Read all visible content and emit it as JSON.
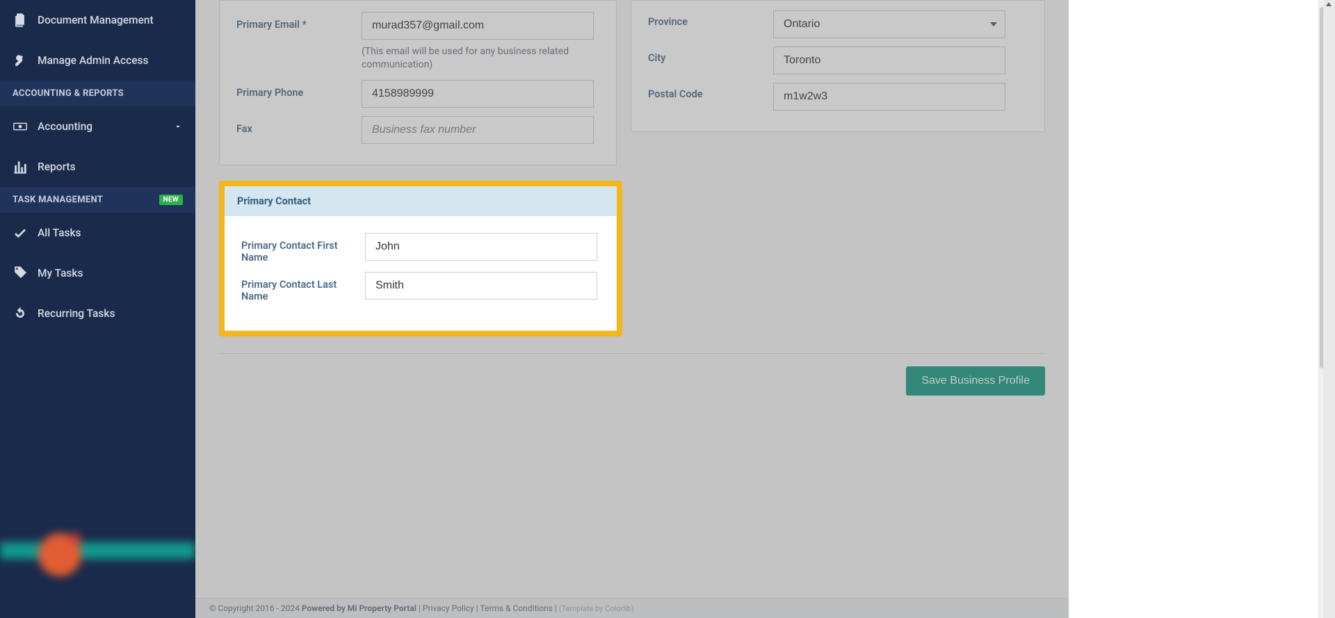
{
  "sidebar": {
    "items": [
      {
        "icon": "documents-icon",
        "label": "Document Management"
      },
      {
        "icon": "key-icon",
        "label": "Manage Admin Access"
      }
    ],
    "section_accounting": "ACCOUNTING & REPORTS",
    "accounting_item": "Accounting",
    "reports_item": "Reports",
    "section_task": "TASK MANAGEMENT",
    "task_badge": "NEW",
    "all_tasks": "All Tasks",
    "my_tasks": "My Tasks",
    "recurring_tasks": "Recurring Tasks"
  },
  "business": {
    "email_label": "Primary Email *",
    "email_value": "murad357@gmail.com",
    "email_help": "(This email will be used for any business related communication)",
    "phone_label": "Primary Phone",
    "phone_value": "4158989999",
    "fax_label": "Fax",
    "fax_placeholder": "Business fax number",
    "province_label": "Province",
    "province_value": "Ontario",
    "city_label": "City",
    "city_value": "Toronto",
    "postal_label": "Postal Code",
    "postal_value": "m1w2w3"
  },
  "primary_contact": {
    "header": "Primary Contact",
    "first_label": "Primary Contact First Name",
    "first_value": "John",
    "last_label": "Primary Contact Last Name",
    "last_value": "Smith"
  },
  "actions": {
    "save": "Save Business Profile"
  },
  "footer": {
    "copyright": "© Copyright 2016 - 2024 ",
    "powered": "Powered by Mi Property Portal",
    "sep1": " | ",
    "privacy": "Privacy Policy",
    "sep2": " | ",
    "terms": "Terms & Conditions",
    "sep3": " | ",
    "template": "(Template by Colorlib)"
  }
}
